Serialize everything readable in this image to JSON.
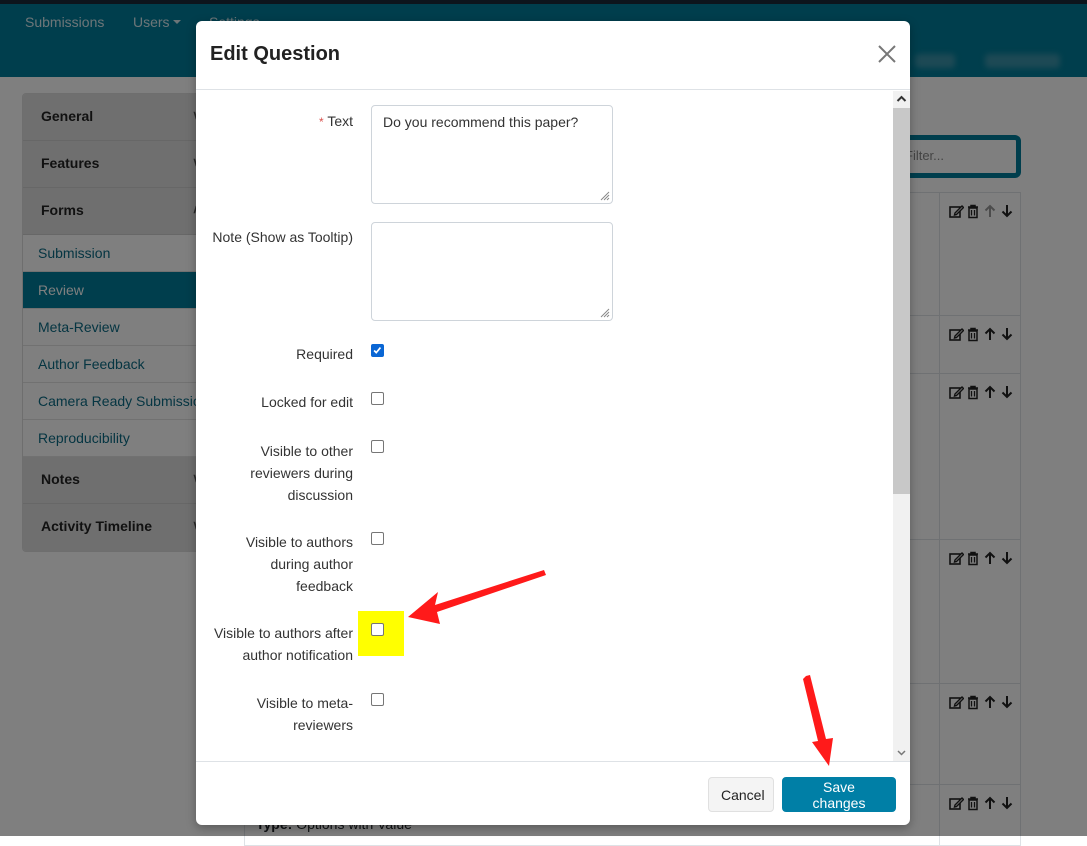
{
  "navbar": {
    "items": [
      {
        "label": "Submissions"
      },
      {
        "label": "Users",
        "has_dropdown": true
      },
      {
        "label": "Settings"
      }
    ]
  },
  "sidebar": {
    "sections": [
      {
        "label": "General",
        "expanded": false
      },
      {
        "label": "Features",
        "expanded": false
      },
      {
        "label": "Forms",
        "expanded": true
      }
    ],
    "forms_items": [
      {
        "label": "Submission"
      },
      {
        "label": "Review",
        "active": true
      },
      {
        "label": "Meta-Review"
      },
      {
        "label": "Author Feedback"
      },
      {
        "label": "Camera Ready Submission"
      },
      {
        "label": "Reproducibility"
      }
    ],
    "after_sections": [
      {
        "label": "Notes",
        "expanded": false
      },
      {
        "label": "Activity Timeline",
        "expanded": false
      }
    ]
  },
  "filter": {
    "placeholder": "Filter..."
  },
  "table": {
    "row_count_visible": 6,
    "first_row_up_disabled": true,
    "bottom_text_label": "Type:",
    "bottom_text_value": "Options with Value"
  },
  "modal": {
    "title": "Edit Question",
    "fields": {
      "text": {
        "label": "Text",
        "required_marker": "*",
        "value": "Do you recommend this paper?"
      },
      "note": {
        "label": "Note (Show as Tooltip)",
        "value": ""
      }
    },
    "checkboxes": [
      {
        "label": "Required",
        "checked": true
      },
      {
        "label": "Locked for edit",
        "checked": false
      },
      {
        "label": "Visible to other reviewers during discussion",
        "checked": false
      },
      {
        "label": "Visible to authors during author feedback",
        "checked": false
      },
      {
        "label": "Visible to authors after author notification",
        "checked": false,
        "highlighted": true
      },
      {
        "label": "Visible to meta-reviewers",
        "checked": false
      }
    ],
    "buttons": {
      "cancel": "Cancel",
      "save": "Save changes"
    }
  },
  "colors": {
    "brand": "#007d9a",
    "primary_button": "#007fa6",
    "highlight": "#ffff00",
    "annotation_arrow": "#ff0000",
    "checkbox_checked": "#0a66d4"
  }
}
